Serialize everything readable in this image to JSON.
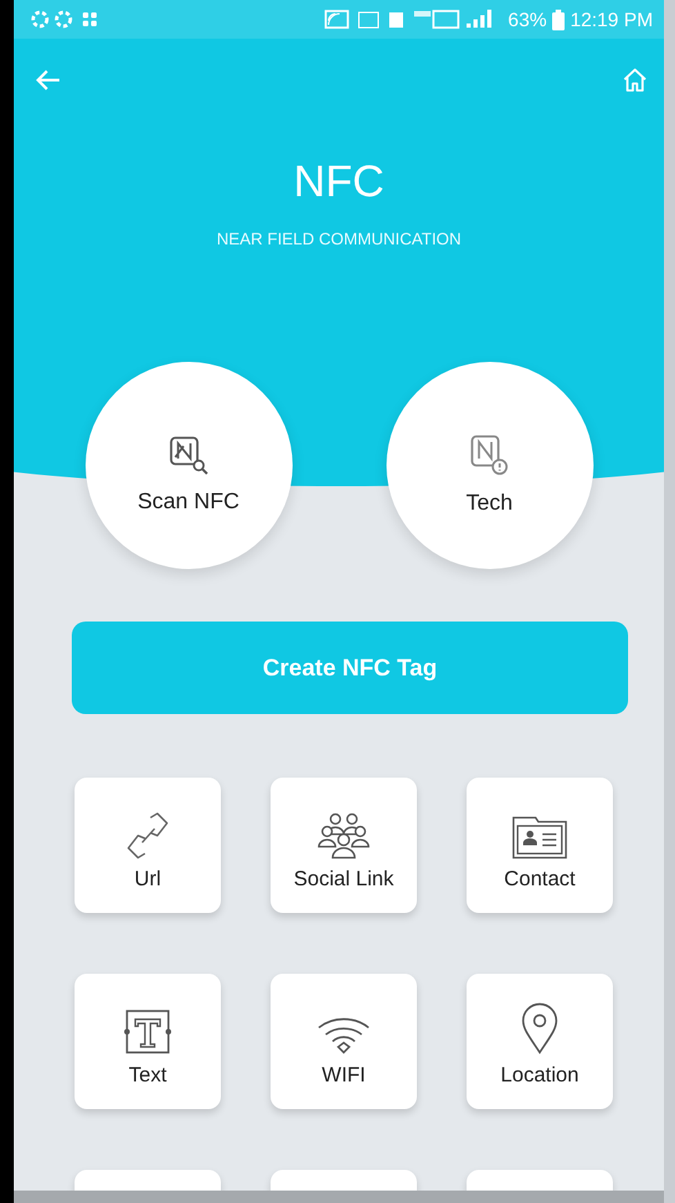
{
  "status_bar": {
    "battery": "63%",
    "time": "12:19 PM"
  },
  "header": {
    "title": "NFC",
    "subtitle": "NEAR FIELD COMMUNICATION"
  },
  "actions": [
    {
      "kind": "scan",
      "label": "Scan NFC"
    },
    {
      "kind": "tech",
      "label": "Tech"
    }
  ],
  "create_button": {
    "label": "Create NFC Tag"
  },
  "tiles": [
    {
      "kind": "url",
      "label": "Url"
    },
    {
      "kind": "social",
      "label": "Social Link"
    },
    {
      "kind": "contact",
      "label": "Contact"
    },
    {
      "kind": "text",
      "label": "Text"
    },
    {
      "kind": "wifi",
      "label": "WIFI"
    },
    {
      "kind": "location",
      "label": "Location"
    }
  ]
}
